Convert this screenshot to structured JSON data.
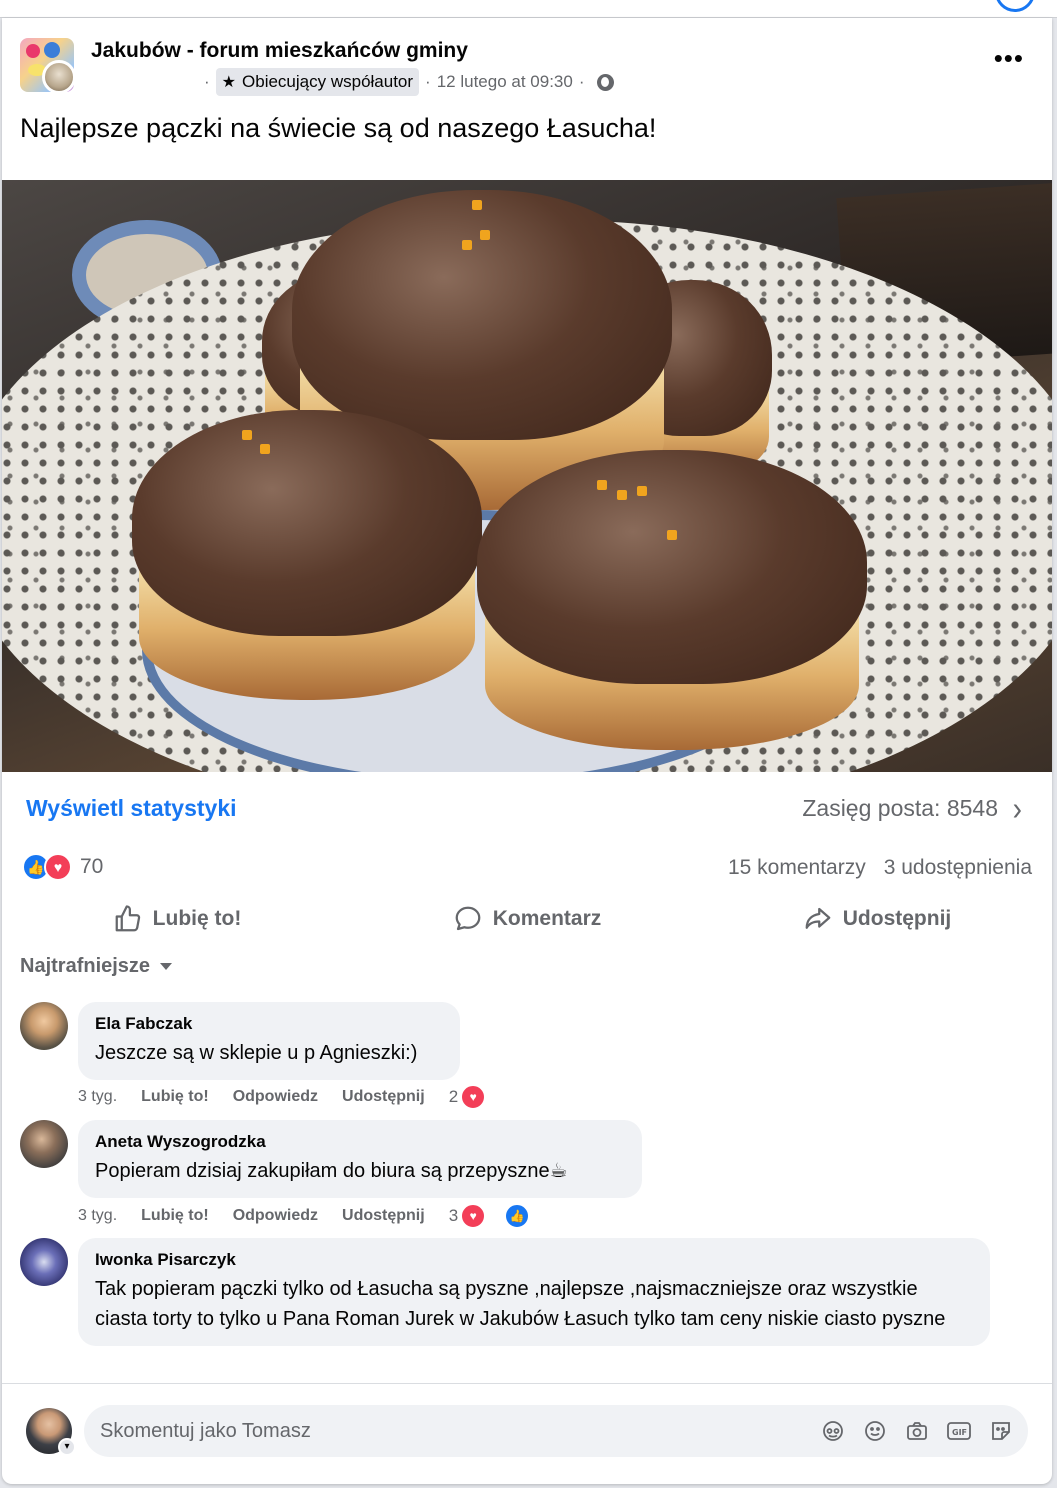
{
  "post": {
    "group_name": "Jakubów - forum mieszkańców gminy",
    "author_separator": "·",
    "badge_label": "Obiecujący współautor",
    "date": "12 lutego at 09:30",
    "title": "Najlepsze pączki na świecie są od naszego Łasucha!"
  },
  "insights": {
    "stats_link": "Wyświetl statystyki",
    "reach_label": "Zasięg posta: 8548"
  },
  "engagement": {
    "reaction_count": "70",
    "comments_count": "15 komentarzy",
    "shares_count": "3 udostępnienia"
  },
  "actions": {
    "like": "Lubię to!",
    "comment": "Komentarz",
    "share": "Udostępnij"
  },
  "sort": {
    "label": "Najtrafniejsze"
  },
  "comments": [
    {
      "name": "Ela Fabczak",
      "text": "Jeszcze są w sklepie u p Agnieszki:)",
      "time": "3 tyg.",
      "like": "Lubię to!",
      "reply": "Odpowiedz",
      "share": "Udostępnij",
      "reactions": "2"
    },
    {
      "name": "Aneta Wyszogrodzka",
      "text": "Popieram dzisiaj zakupiłam do biura są przepyszne☕",
      "time": "3 tyg.",
      "like": "Lubię to!",
      "reply": "Odpowiedz",
      "share": "Udostępnij",
      "reactions": "3"
    },
    {
      "name": "Iwonka Pisarczyk",
      "text": "Tak popieram pączki tylko od Łasucha są pyszne ,najlepsze ,najsmaczniejsze oraz wszystkie ciasta torty to tylko u Pana Roman Jurek w Jakubów Łasuch tylko tam ceny niskie ciasto pyszne"
    }
  ],
  "composer": {
    "placeholder": "Skomentuj jako Tomasz",
    "tools": [
      "avatar-sticker-icon",
      "emoji-icon",
      "camera-icon",
      "gif-icon",
      "sticker-icon"
    ]
  },
  "colors": {
    "accent": "#1877f2",
    "love": "#f33e58",
    "secondary_text": "#65676b",
    "bubble": "#f0f2f5"
  }
}
